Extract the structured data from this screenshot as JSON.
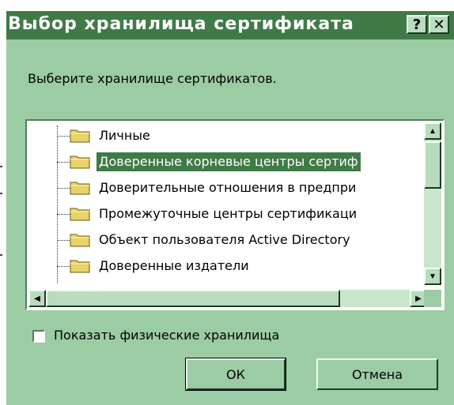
{
  "dialog": {
    "title": "Выбор хранилища сертификата",
    "help_glyph": "?",
    "close_glyph": "✕",
    "prompt": "Выберите хранилище сертификатов.",
    "tree": {
      "items": [
        {
          "label": "Личные",
          "selected": false
        },
        {
          "label": "Доверенные корневые центры сертиф",
          "selected": true
        },
        {
          "label": "Доверительные отношения в предпри",
          "selected": false
        },
        {
          "label": "Промежуточные центры сертификаци",
          "selected": false
        },
        {
          "label": "Объект пользователя Active Directory",
          "selected": false
        },
        {
          "label": "Доверенные издатели",
          "selected": false
        }
      ]
    },
    "checkbox": {
      "label": "Показать физические хранилища",
      "checked": false
    },
    "buttons": {
      "ok": "ОК",
      "cancel": "Отмена"
    },
    "scroll": {
      "up": "▲",
      "down": "▼",
      "left": "◀",
      "right": "▶"
    }
  },
  "colors": {
    "title_bg": "#3f7a47",
    "dialog_bg": "#9ccca4",
    "selection": "#3f7a47"
  }
}
